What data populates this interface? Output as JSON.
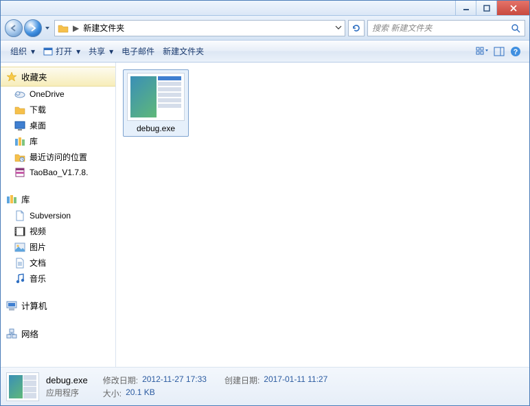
{
  "breadcrumb": {
    "segment": "新建文件夹"
  },
  "search": {
    "placeholder": "搜索 新建文件夹"
  },
  "toolbar": {
    "organize": "组织",
    "open": "打开",
    "share": "共享",
    "email": "电子邮件",
    "newfolder": "新建文件夹"
  },
  "sidebar": {
    "favorites_label": "收藏夹",
    "favorites": [
      {
        "label": "OneDrive",
        "icon": "cloud"
      },
      {
        "label": "下载",
        "icon": "folder"
      },
      {
        "label": "桌面",
        "icon": "desktop"
      },
      {
        "label": "库",
        "icon": "libraries"
      },
      {
        "label": "最近访问的位置",
        "icon": "recent"
      },
      {
        "label": "TaoBao_V1.7.8.",
        "icon": "archive"
      }
    ],
    "libraries_label": "库",
    "libraries": [
      {
        "label": "Subversion",
        "icon": "doc"
      },
      {
        "label": "视频",
        "icon": "video"
      },
      {
        "label": "图片",
        "icon": "picture"
      },
      {
        "label": "文档",
        "icon": "doc"
      },
      {
        "label": "音乐",
        "icon": "music"
      }
    ],
    "computer_label": "计算机",
    "network_label": "网络"
  },
  "file": {
    "name": "debug.exe"
  },
  "details": {
    "name": "debug.exe",
    "type": "应用程序",
    "modified_label": "修改日期:",
    "modified": "2012-11-27 17:33",
    "created_label": "创建日期:",
    "created": "2017-01-11 11:27",
    "size_label": "大小:",
    "size": "20.1 KB"
  }
}
